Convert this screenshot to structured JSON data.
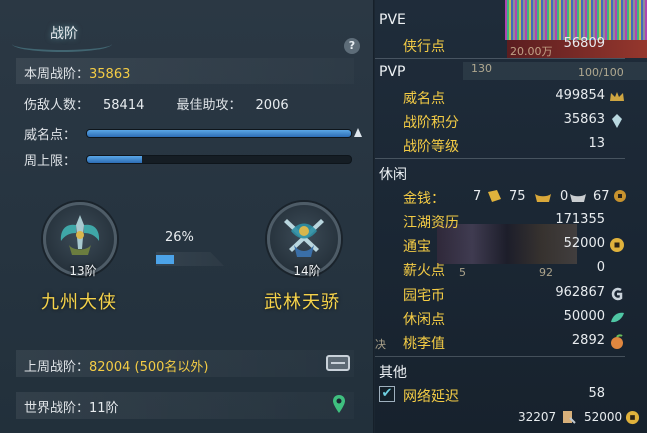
{
  "rank_panel": {
    "title": "战阶",
    "help_icon": "help-icon",
    "week_score_label": "本周战阶：",
    "week_score_value": "35863",
    "defeated_label": "伤敌人数：",
    "defeated_value": "58414",
    "assist_label": "最佳助攻：",
    "assist_value": "2006",
    "prestige_label": "威名点：",
    "prestige_progress": 1.0,
    "weekly_cap_label": "周上限：",
    "weekly_cap_progress": 0.21,
    "current_tier": {
      "level": "13阶",
      "name": "九州大侠",
      "icon": "winged-sword-emblem-icon"
    },
    "next_tier": {
      "level": "14阶",
      "name": "武林天骄",
      "icon": "crossed-swords-emblem-icon"
    },
    "tier_progress_text": "26%",
    "tier_progress": 0.26,
    "last_week_label": "上周战阶：",
    "last_week_value": "82004 (500名以外)",
    "last_week_icon": "chest-icon",
    "world_rank_label": "世界战阶：",
    "world_rank_value": "11阶",
    "world_rank_icon": "location-pin-icon"
  },
  "stats_panel": {
    "background_texts": [
      "20.00万",
      "130",
      "100/100",
      "5",
      "92",
      "决"
    ],
    "pve": {
      "title": "PVE",
      "items": [
        {
          "label": "侠行点",
          "value": "56809"
        }
      ]
    },
    "pvp": {
      "title": "PVP",
      "items": [
        {
          "label": "威名点",
          "value": "499854",
          "icon": "prestige-crown-icon"
        },
        {
          "label": "战阶积分",
          "value": "35863",
          "icon": "rank-crystal-icon"
        },
        {
          "label": "战阶等级",
          "value": "13"
        }
      ]
    },
    "leisure": {
      "title": "休闲",
      "money": {
        "label": "金钱：",
        "gold": "7",
        "silver": "75",
        "copper": "0",
        "coin": "67"
      },
      "items": [
        {
          "label": "江湖资历",
          "value": "171355"
        },
        {
          "label": "通宝",
          "value": "52000",
          "icon": "tongbao-coin-icon"
        },
        {
          "label": "薪火点",
          "value": "0"
        },
        {
          "label": "园宅币",
          "value": "962867",
          "icon": "home-coin-icon"
        },
        {
          "label": "休闲点",
          "value": "50000",
          "icon": "leaf-icon"
        },
        {
          "label": "桃李值",
          "value": "2892",
          "icon": "peach-icon"
        }
      ]
    },
    "other": {
      "title": "其他",
      "items": [
        {
          "label": "网络延迟",
          "value": "58",
          "checked": true
        }
      ]
    },
    "footer": {
      "left_value": "32207",
      "right_value": "52000"
    }
  },
  "colors": {
    "accent_yellow": "#f4cc45",
    "bar_blue": "#4ca3e8",
    "panel_bg": "#263440"
  }
}
